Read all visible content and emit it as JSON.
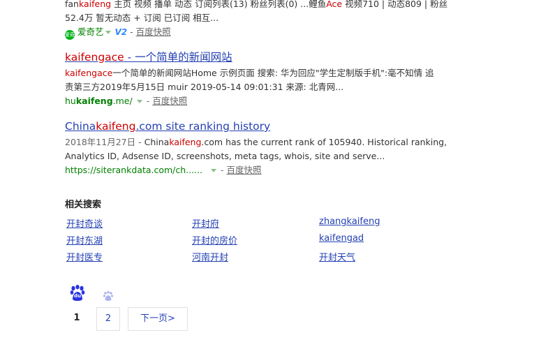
{
  "result0": {
    "line1_pre": "fan",
    "line1_hl": "kaifeng",
    "line1_post": " 主页 视频 播单 动态 订阅列表(13) 粉丝列表(0) ...鲤鱼",
    "line1_hl2": "Ace",
    "line1_post2": " 视频710 | 动态809 | 粉丝",
    "line2": "52.4万 暂无动态 + 订阅 已订阅 相互...",
    "source_icon_text": "爱奇",
    "source": "爱奇艺",
    "v2": "V2",
    "sep": "-",
    "snapshot": "百度快照"
  },
  "result1": {
    "title_hl": "kaifengace",
    "title_rest": " - 一个简单的新闻网站",
    "snip1_hl": "kaifengace",
    "snip1_rest": "一个简单的新闻网站Home 示例页面 搜索: 华为回应\"学生定制版手机\":毫不知情 追",
    "snip2": "责第三方2019年5月15日 muir 2019-05-14 09:01:31 来源: 北青网...",
    "url_pre": "hu",
    "url_bold": "kaifeng",
    "url_post": ".me/",
    "sep": "-",
    "snapshot": "百度快照"
  },
  "result2": {
    "title_pre": "China",
    "title_hl": "kaifeng",
    "title_post": ".com site ranking history",
    "snip1_date": "2018年11月27日 - ",
    "snip1_pre": "China",
    "snip1_hl": "kaifeng",
    "snip1_post": ".com has the current rank of 105940. Historical ranking,",
    "snip2": "Analytics ID, Adsense ID, screenshots, meta tags, whois, site and serve...",
    "url": "https://siterankdata.com/ch......",
    "sep": "-",
    "snapshot": "百度快照"
  },
  "related": {
    "title": "相关搜索",
    "items": [
      "开封奇谈",
      "开封府",
      "zhangkaifeng",
      "开封东湖",
      "开封的房价",
      "kaifengad",
      "开封医专",
      "河南开封",
      "开封天气"
    ]
  },
  "pagination": {
    "logo": "du",
    "current": "1",
    "page2": "2",
    "next": "下一页>"
  }
}
